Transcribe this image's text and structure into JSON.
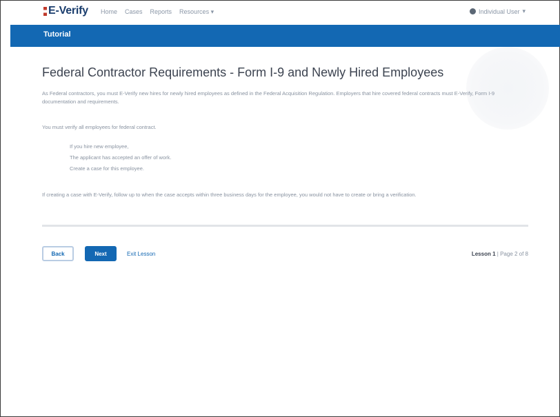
{
  "app": {
    "logo_text": "E-Verify",
    "nav": [
      "Home",
      "Cases",
      "Reports",
      "Resources"
    ],
    "user_menu_label": "Individual User"
  },
  "banner": {
    "title": "Tutorial"
  },
  "page": {
    "title": "Federal Contractor Requirements - Form I-9 and Newly Hired Employees",
    "paragraph1": "As Federal contractors, you must E-Verify new hires for newly hired employees as defined in the Federal Acquisition Regulation. Employers that hire covered federal contracts must E-Verify, Form I-9 documentation and requirements.",
    "paragraph2": "You must verify all employees for federal contract.",
    "list": [
      {
        "text": "If you hire new employee,"
      },
      {
        "text": "The applicant has accepted an offer of work."
      },
      {
        "text": "Create a case for this employee."
      }
    ],
    "paragraph3": "If creating a case with E-Verify, follow up to when the case accepts within three business days for the employee, you would not have to create or bring a verification."
  },
  "footer": {
    "back_label": "Back",
    "next_label": "Next",
    "exit_label": "Exit Lesson",
    "lesson_label": "Lesson 1",
    "page_label": "Page 2 of 8"
  },
  "colors": {
    "brand_blue": "#1368b3",
    "banner_text": "#ffffff"
  }
}
